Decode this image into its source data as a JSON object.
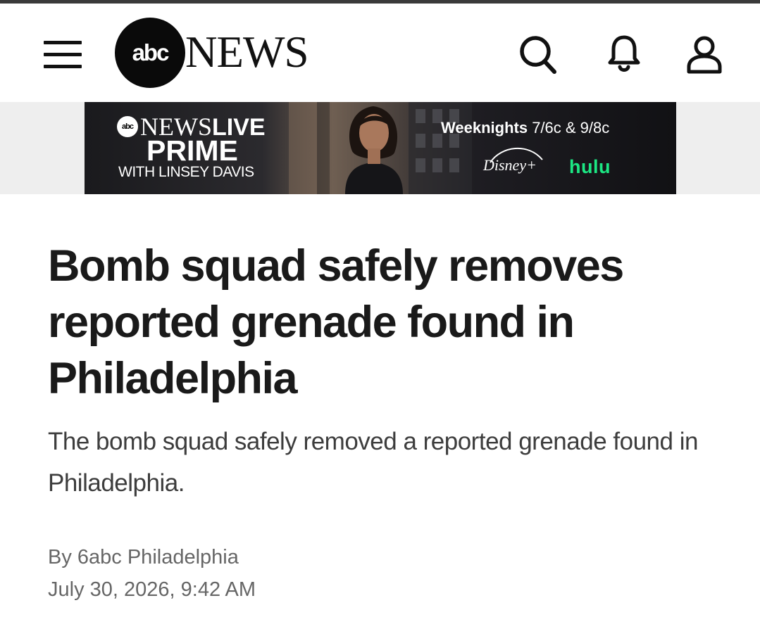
{
  "header": {
    "menu_icon": "hamburger-menu-icon",
    "logo": {
      "circle_text": "abc",
      "wordmark": "NEWS"
    },
    "icons": [
      "search-icon",
      "bell-icon",
      "user-icon"
    ]
  },
  "banner": {
    "logo_abc": "abc",
    "logo_news": "NEWS",
    "logo_live": "LIVE",
    "prime": "PRIME",
    "with": "WITH LINSEY DAVIS",
    "schedule_bold": "Weeknights",
    "schedule_times": "7/6c & 9/8c",
    "disney": "Disney+",
    "hulu": "hulu"
  },
  "article": {
    "headline": "Bomb squad safely removes reported grenade found in Philadelphia",
    "subheadline": "The bomb squad safely removed a reported grenade found in Philadelphia.",
    "byline": "By 6abc Philadelphia",
    "date": "July 30, 2026, 9:42 AM"
  },
  "colors": {
    "text": "#1a1a1a",
    "muted": "#666666",
    "hulu_green": "#1ce783",
    "banner_strip": "#eeeeee"
  }
}
